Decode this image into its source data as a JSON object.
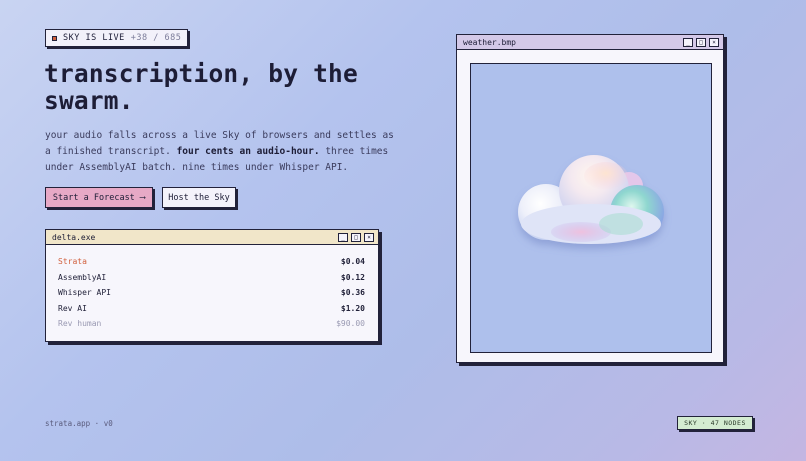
{
  "badge": {
    "live": "SKY IS LIVE",
    "count": "+38 / 685"
  },
  "hero": {
    "title_line1": "transcription, by the",
    "title_line2": "swarm.",
    "lede_a": "your audio falls across a live Sky of browsers and settles as a finished transcript.",
    "lede_bold": "four cents an audio-hour.",
    "lede_b": "three times under AssemblyAI batch. nine times under Whisper API."
  },
  "buttons": {
    "primary": "Start a Forecast",
    "primary_arrow": "⟶",
    "secondary": "Host the Sky"
  },
  "window_controls": {
    "minimize": "_",
    "maximize": "□",
    "close": "×"
  },
  "delta": {
    "title": "delta.exe",
    "rows": [
      {
        "label": "Strata",
        "value": "$0.04"
      },
      {
        "label": "AssemblyAI",
        "value": "$0.12"
      },
      {
        "label": "Whisper API",
        "value": "$0.36"
      },
      {
        "label": "Rev AI",
        "value": "$1.20"
      },
      {
        "label": "Rev human",
        "value": "$90.00"
      }
    ]
  },
  "weather": {
    "title": "weather.bmp",
    "image_icon": "cloud-icon"
  },
  "footer": {
    "left": "strata.app · v0",
    "nodes": "SKY · 47 NODES"
  },
  "colors": {
    "accent": "#d1603d",
    "primary_button": "#e7a9c6",
    "delta_titlebar": "#f1e6c9",
    "weather_titlebar": "#d4c9e8",
    "nodes_badge": "#d4ecd1"
  }
}
